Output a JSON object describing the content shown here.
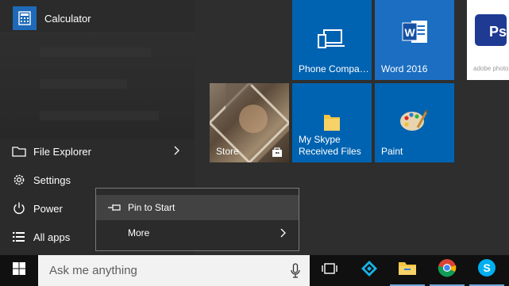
{
  "start_menu": {
    "most_used": [
      {
        "label": "Calculator",
        "icon": "calculator-icon"
      }
    ],
    "nav": {
      "file_explorer": "File Explorer",
      "settings": "Settings",
      "power": "Power",
      "all_apps": "All apps"
    }
  },
  "tiles": {
    "phone_companion": "Phone Compa…",
    "word_2016": "Word 2016",
    "photoshop_caption": "adobe photos",
    "store": "Store",
    "skype_received": "My Skype Received Files",
    "paint": "Paint"
  },
  "context_menu": {
    "pin_to_start": "Pin to Start",
    "more": "More"
  },
  "taskbar": {
    "search_placeholder": "Ask me anything"
  },
  "colors": {
    "tile_blue": "#0063b1",
    "tile_blue_light": "#1a78c2",
    "start_bg": "#2b2b2b",
    "taskbar_bg": "#101010"
  }
}
